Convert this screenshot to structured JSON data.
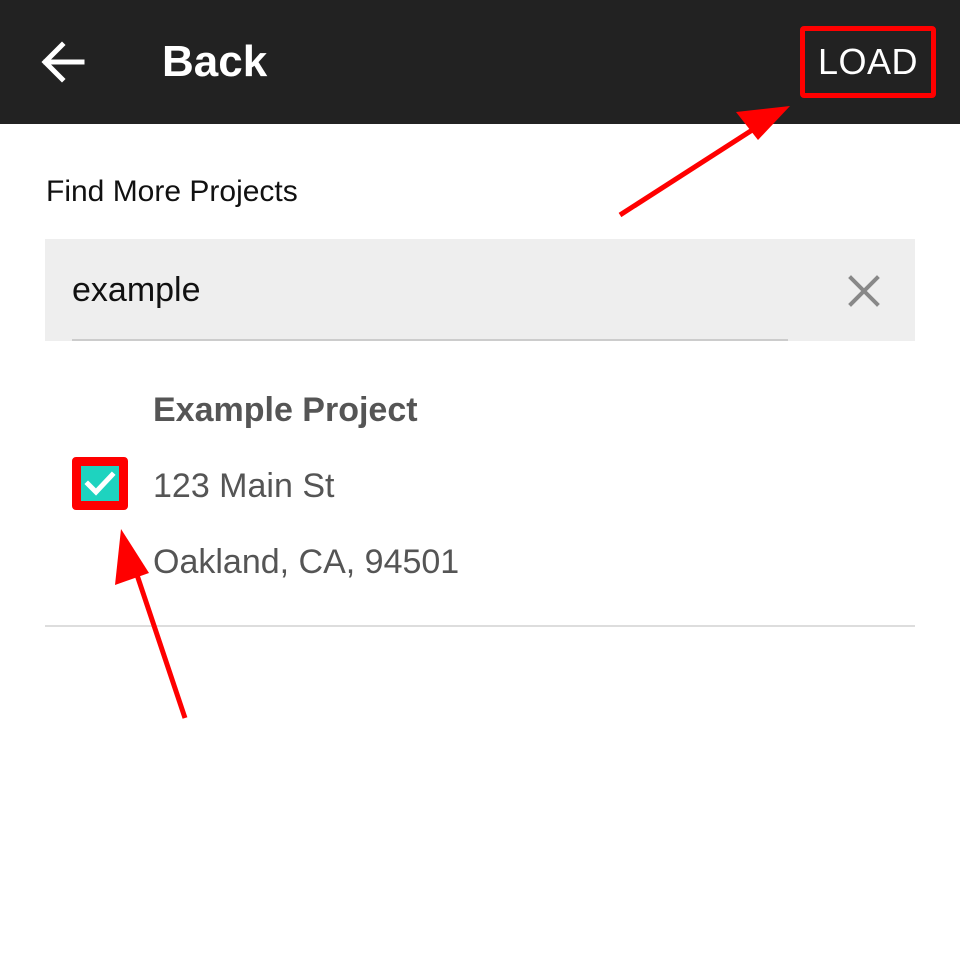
{
  "toolbar": {
    "back_icon": "arrow-left-icon",
    "back_label": "Back",
    "load_label": "LOAD"
  },
  "section": {
    "title": "Find More Projects"
  },
  "search": {
    "value": "example",
    "clear_icon": "close-icon"
  },
  "results": [
    {
      "name": "Example Project",
      "address": "123 Main St",
      "city": "Oakland, CA, 94501",
      "checked": true
    }
  ],
  "colors": {
    "toolbar_bg": "#222222",
    "checkbox_accent": "#1ed3bf",
    "annotation_red": "#ff0000",
    "search_bg": "#eeeeee"
  }
}
